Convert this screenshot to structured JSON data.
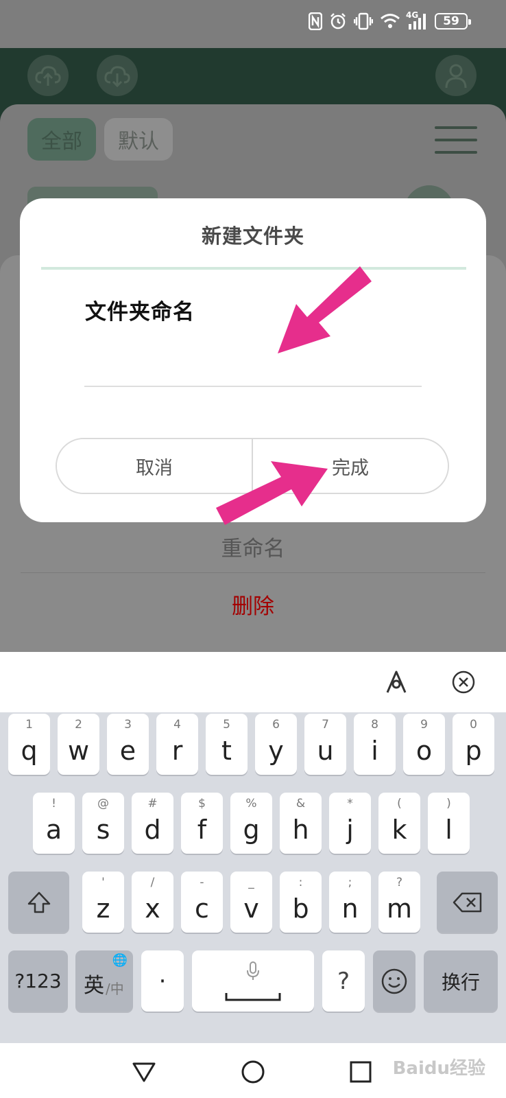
{
  "status_bar": {
    "battery_level": "59",
    "network_label": "4G",
    "icons": [
      "nfc-icon",
      "alarm-icon",
      "vibrate-icon",
      "wifi-icon",
      "signal-icon",
      "battery-icon"
    ]
  },
  "header": {
    "icons": [
      "upload-cloud-icon",
      "download-cloud-icon",
      "user-icon"
    ]
  },
  "filter_tabs": [
    {
      "label": "全部",
      "active": true
    },
    {
      "label": "默认",
      "active": false
    }
  ],
  "sheet": {
    "rename_label": "重命名",
    "delete_label": "删除",
    "delete_color": "#a30000"
  },
  "dialog": {
    "title": "新建文件夹",
    "field_label": "文件夹命名",
    "field_value": "",
    "cancel_label": "取消",
    "done_label": "完成",
    "title_line_color": "#d2e9dd"
  },
  "annotation": {
    "arrow_color": "#e62e8c"
  },
  "keyboard": {
    "row1": [
      {
        "hint": "1",
        "key": "q"
      },
      {
        "hint": "2",
        "key": "w"
      },
      {
        "hint": "3",
        "key": "e"
      },
      {
        "hint": "4",
        "key": "r"
      },
      {
        "hint": "5",
        "key": "t"
      },
      {
        "hint": "6",
        "key": "y"
      },
      {
        "hint": "7",
        "key": "u"
      },
      {
        "hint": "8",
        "key": "i"
      },
      {
        "hint": "9",
        "key": "o"
      },
      {
        "hint": "0",
        "key": "p"
      }
    ],
    "row2": [
      {
        "hint": "!",
        "key": "a"
      },
      {
        "hint": "@",
        "key": "s"
      },
      {
        "hint": "#",
        "key": "d"
      },
      {
        "hint": "$",
        "key": "f"
      },
      {
        "hint": "%",
        "key": "g"
      },
      {
        "hint": "&",
        "key": "h"
      },
      {
        "hint": "*",
        "key": "j"
      },
      {
        "hint": "(",
        "key": "k"
      },
      {
        "hint": ")",
        "key": "l"
      }
    ],
    "row3": [
      {
        "hint": "'",
        "key": "z"
      },
      {
        "hint": "/",
        "key": "x"
      },
      {
        "hint": "-",
        "key": "c"
      },
      {
        "hint": "_",
        "key": "v"
      },
      {
        "hint": ":",
        "key": "b"
      },
      {
        "hint": ";",
        "key": "n"
      },
      {
        "hint": "?",
        "key": "m"
      }
    ],
    "num_label": "?123",
    "lang_label": "英",
    "lang_sub_label": "/中",
    "dot_label": "·",
    "question_label": "?",
    "enter_label": "换行"
  },
  "watermark": "Baidu经验"
}
